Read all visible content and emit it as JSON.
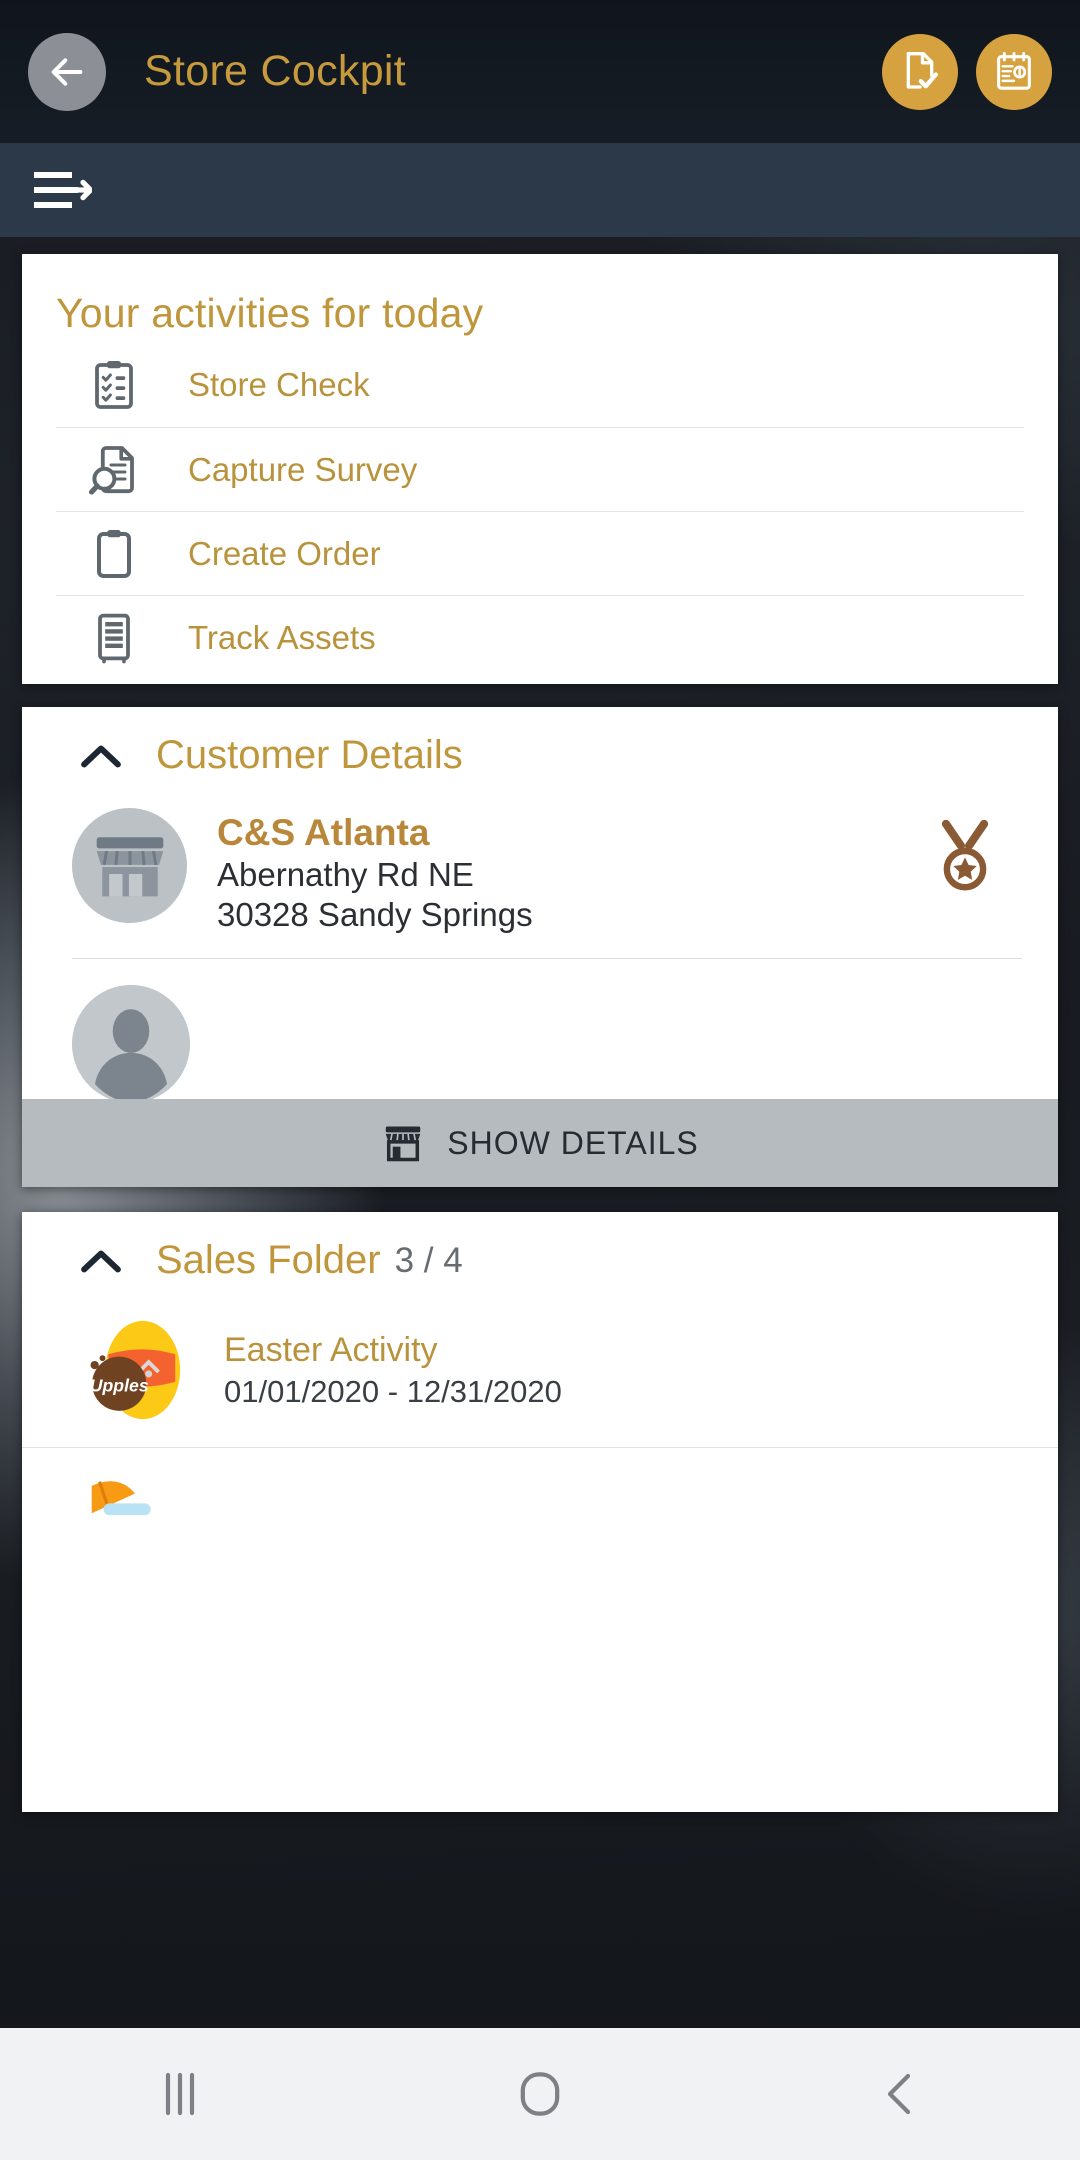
{
  "appbar": {
    "title": "Store Cockpit",
    "back_icon": "arrow-left-icon",
    "actions": [
      {
        "name": "document-check-icon",
        "label": "Document Check"
      },
      {
        "name": "order-clipboard-icon",
        "label": "Order Clipboard"
      }
    ]
  },
  "subbar": {
    "menu_icon": "menu-arrow-icon"
  },
  "activities": {
    "title": "Your activities for today",
    "items": [
      {
        "label": "Store Check",
        "icon": "checklist-clipboard-icon"
      },
      {
        "label": "Capture Survey",
        "icon": "document-search-icon"
      },
      {
        "label": "Create Order",
        "icon": "clipboard-icon"
      },
      {
        "label": "Track Assets",
        "icon": "cabinet-icon"
      }
    ]
  },
  "customer": {
    "section_title": "Customer Details",
    "collapse_icon": "chevron-up-icon",
    "name": "C&S Atlanta",
    "street": "Abernathy Rd NE",
    "city": "30328 Sandy Springs",
    "badge_icon": "medal-star-icon",
    "store_avatar_icon": "storefront-icon",
    "contact_avatar_icon": "person-avatar-icon",
    "show_details_label": "SHOW DETAILS",
    "show_details_icon": "storefront-icon"
  },
  "sales_folder": {
    "section_title": "Sales Folder",
    "count": "3 / 4",
    "collapse_icon": "chevron-up-icon",
    "items": [
      {
        "title": "Easter Activity",
        "dates": "01/01/2020 - 12/31/2020",
        "thumb": "easter-egg-upples-icon"
      },
      {
        "title": "",
        "dates": "",
        "thumb": "promo-partial-icon"
      }
    ]
  },
  "navbar": {
    "buttons": [
      {
        "name": "recents-button",
        "icon": "recents-icon"
      },
      {
        "name": "home-button",
        "icon": "home-icon"
      },
      {
        "name": "back-button",
        "icon": "chevron-left-icon"
      }
    ]
  },
  "colors": {
    "gold": "#c0963c",
    "gold_fab": "#d6a23f",
    "subbar": "#2c3949",
    "appbar": "#141a22",
    "show_details_bg": "#b6bbc0",
    "bronze": "#8a5a34"
  }
}
